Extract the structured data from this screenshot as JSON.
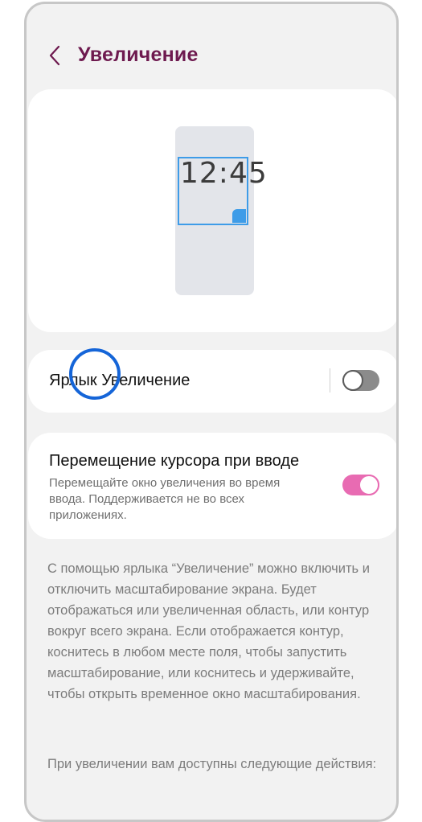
{
  "header": {
    "title": "Увеличение",
    "back_icon": "chevron-left-icon"
  },
  "preview": {
    "clock_text": "12:45",
    "accent_color": "#3e9ce8"
  },
  "shortcut": {
    "label": "Ярлык Увеличение",
    "toggle_on": false
  },
  "cursor_follow": {
    "title": "Перемещение курсора при вводе",
    "description": "Перемещайте окно увеличения во время ввода. Поддерживается не во всех приложениях.",
    "toggle_on": true,
    "accent_color": "#e86bb2"
  },
  "info": {
    "paragraph_1": "С помощью ярлыка “Увеличение” можно включить и отключить масштабирование экрана. Будет отображаться или увеличенная область, или контур вокруг всего экрана. Если отображается контур, коснитесь в любом месте поля, чтобы запустить масштабирование, или коснитесь и удерживайте, чтобы открыть временное окно масштабирования.",
    "paragraph_2": "При увеличении вам доступны следующие действия:"
  }
}
